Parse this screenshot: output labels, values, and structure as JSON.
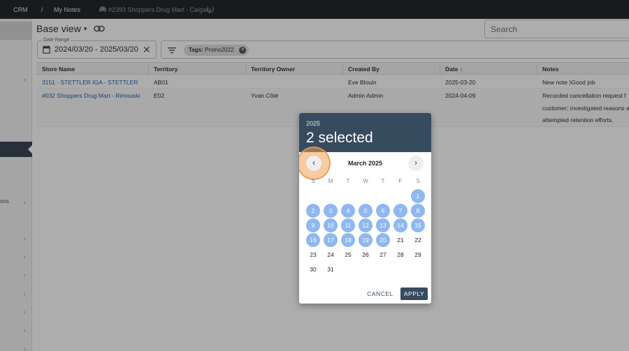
{
  "topbar": {
    "crumbs": [
      "CRM",
      "/",
      "My Notes"
    ],
    "record_title": "#2393 Shoppers Drug Mart - Calgary",
    "icons": [
      "car-icon",
      "loading-spinner-icon"
    ]
  },
  "sidebar": {
    "partial_label": "ons",
    "chevron": "›"
  },
  "header": {
    "view_title": "Base view",
    "caret": "▾",
    "search_placeholder": "Search"
  },
  "filters": {
    "date_range_label": "Date Range",
    "date_range_value": "2024/03/20 - 2025/03/20",
    "clear": "✕",
    "chip_label": "Tags:",
    "chip_value": "Promo2022",
    "chip_remove": "✕"
  },
  "table": {
    "columns": [
      "Store Name",
      "Territory",
      "Territory Owner",
      "Created By",
      "Date",
      "Notes"
    ],
    "sort_arrow": "↓",
    "rows": [
      {
        "store": "3151 - STETTLER IGA - STETTLER",
        "territory": "AB01",
        "owner": "",
        "created_by": "Eve Blouin",
        "date": "2025-03-20",
        "notes": [
          "New note )Good job"
        ]
      },
      {
        "store": "#032 Shoppers Drug Mart - Rimouski",
        "territory": "E02",
        "owner": "Yvan Côté",
        "created_by": "Admin Admin",
        "date": "2024-04-09",
        "notes": [
          "Recorded cancellation request f",
          "customer; investigated reasons a",
          "attempted retention efforts."
        ]
      }
    ]
  },
  "datepicker": {
    "year": "2025",
    "selected_text": "2 selected",
    "month_label": "March 2025",
    "prev": "‹",
    "next": "›",
    "weekdays": [
      "S",
      "M",
      "T",
      "W",
      "T",
      "F",
      "S"
    ],
    "first_weekday": 6,
    "days_in_month": 31,
    "range_end_day": 20,
    "range_color": "#90b8f0",
    "header_color": "#374b5f",
    "cancel_label": "CANCEL",
    "apply_label": "APPLY"
  }
}
